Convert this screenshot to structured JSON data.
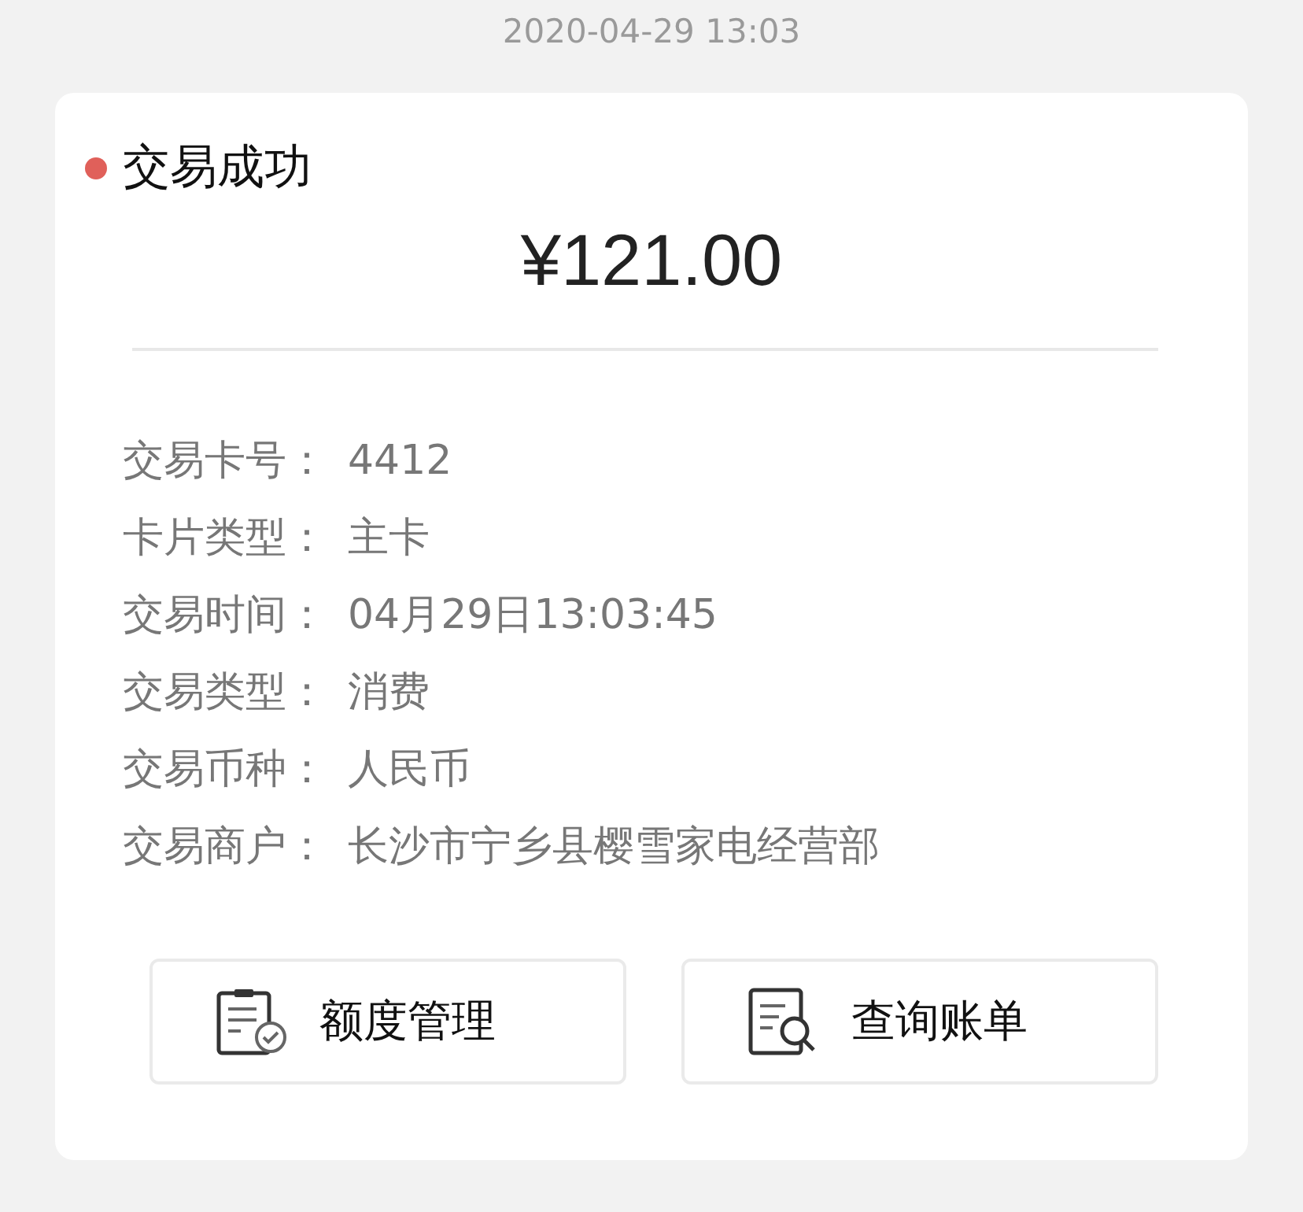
{
  "timestamp": "2020-04-29 13:03",
  "status": {
    "label": "交易成功",
    "color": "#e0605a"
  },
  "amount": "¥121.00",
  "details": [
    {
      "label": "交易卡号：",
      "value": "4412"
    },
    {
      "label": "卡片类型：",
      "value": "主卡"
    },
    {
      "label": "交易时间：",
      "value": "04月29日13:03:45"
    },
    {
      "label": "交易类型：",
      "value": "消费"
    },
    {
      "label": "交易币种：",
      "value": "人民币"
    },
    {
      "label": "交易商户：",
      "value": "长沙市宁乡县樱雪家电经营部"
    }
  ],
  "buttons": [
    {
      "kind": "limit",
      "label": "额度管理"
    },
    {
      "kind": "bill",
      "label": "查询账单"
    }
  ]
}
